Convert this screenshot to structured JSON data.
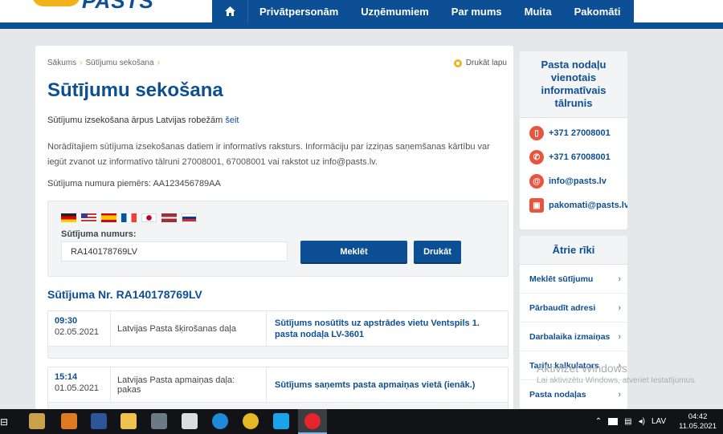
{
  "header": {
    "logo_text": "PASTS",
    "nav": [
      "Privātpersonām",
      "Uzņēmumiem",
      "Par mums",
      "Muita",
      "Pakomāti"
    ]
  },
  "breadcrumb": [
    "Sākums",
    "Sūtījumu sekošana"
  ],
  "print_link": "Drukāt lapu",
  "page_title": "Sūtījumu sekošana",
  "intro": {
    "text": "Sūtījumu izsekošana ārpus Latvijas robežām ",
    "link": "šeit"
  },
  "notice": "Norādītajiem sūtījuma izsekošanas datiem ir informatīvs raksturs. Informāciju par izziņas saņemšanas kārtību var iegūt zvanot uz informatīvo tālruni 27008001, 67008001 vai rakstot uz info@pasts.lv.",
  "example": "Sūtījuma numura piemērs: AA123456789AA",
  "search": {
    "flags": [
      "de",
      "us",
      "es",
      "fr",
      "jp",
      "lv",
      "ru"
    ],
    "label": "Sūtījuma numurs:",
    "value": "RA140178769LV",
    "search_button": "Meklēt",
    "print_button": "Drukāt"
  },
  "result_title": "Sūtījuma Nr. RA140178769LV",
  "events": [
    {
      "time": "09:30",
      "date": "02.05.2021",
      "location": "Latvijas Pasta šķirošanas daļa",
      "status": "Sūtījums nosūtīts uz apstrādes vietu Ventspils 1. pasta nodaļa LV-3601"
    },
    {
      "time": "15:14",
      "date": "01.05.2021",
      "location": "Latvijas Pasta apmaiņas daļa: pakas",
      "status": "Sūtījums saņemts pasta apmaiņas vietā (ienāk.)"
    }
  ],
  "sidebar_contacts": {
    "title": "Pasta nodaļu vienotais informatīvais tālrunis",
    "items": [
      "+371 27008001",
      "+371 67008001",
      "info@pasts.lv",
      "pakomati@pasts.lv"
    ]
  },
  "sidebar_tools": {
    "title": "Ātrie rīki",
    "items": [
      "Meklēt sūtījumu",
      "Pārbaudīt adresi",
      "Darbalaika izmaiņas",
      "Tarifu kalkulators",
      "Pasta nodaļas"
    ]
  },
  "watermark": {
    "line1": "Aktivizēt Windows",
    "line2": "Lai aktivizētu Windows, atveriet Iestatījumus."
  },
  "taskbar": {
    "lang": "LAV",
    "time": "04:42",
    "date": "11.05.2021"
  },
  "colors": {
    "brand_blue": "#0d4f95",
    "accent_yellow": "#f3b21b",
    "contact_icon_red": "#e8553f"
  }
}
